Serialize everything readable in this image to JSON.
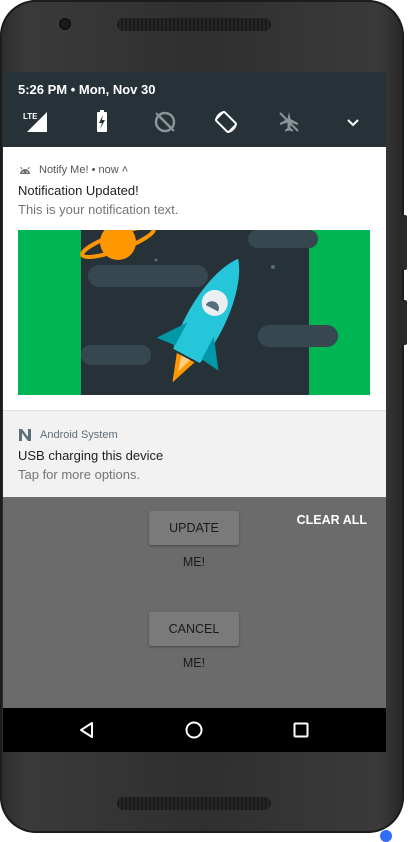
{
  "status_bar": {
    "time": "5:26 PM • Mon, Nov 30"
  },
  "quick_settings": [
    {
      "name": "lte-signal-icon"
    },
    {
      "name": "battery-charging-icon"
    },
    {
      "name": "do-not-disturb-off-icon"
    },
    {
      "name": "auto-rotate-icon"
    },
    {
      "name": "airplane-mode-icon"
    },
    {
      "name": "expand-chevron-icon"
    }
  ],
  "notifications": [
    {
      "app": "Notify Me! • now ˄",
      "title": "Notification Updated!",
      "text": "This is your notification text."
    },
    {
      "app": "Android System",
      "title": "USB charging this device",
      "text": "Tap for more options."
    }
  ],
  "actions": {
    "clear_all": "CLEAR ALL"
  },
  "app": {
    "update_button": "UPDATE ME!",
    "cancel_button": "CANCEL ME!"
  },
  "colors": {
    "shade": "#263238",
    "image_green": "#00b553",
    "image_dark": "#263238",
    "rocket": "#26c6da",
    "planet": "#ff9800"
  }
}
